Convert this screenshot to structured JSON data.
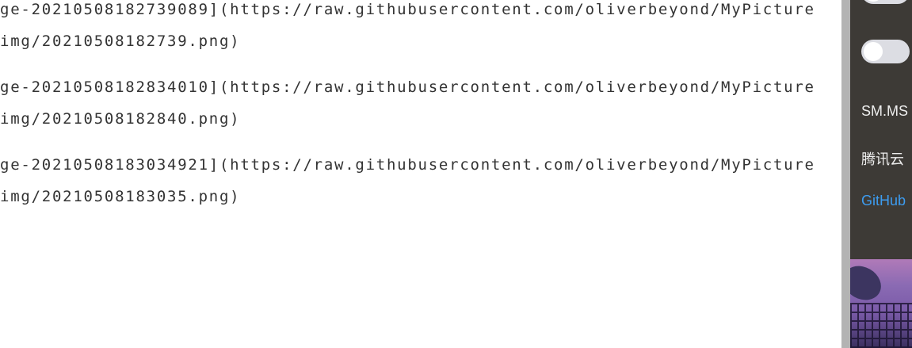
{
  "editor": {
    "lines": [
      "ge-20210508182739089](https://raw.githubusercontent.com/oliverbeyond/MyPicture",
      "img/20210508182739.png)",
      "ge-20210508182834010](https://raw.githubusercontent.com/oliverbeyond/MyPicture",
      "img/20210508182840.png)",
      "ge-20210508183034921](https://raw.githubusercontent.com/oliverbeyond/MyPicture",
      "img/20210508183035.png)"
    ]
  },
  "panel": {
    "toggles": [
      {
        "on": false
      },
      {
        "on": false
      }
    ],
    "options": [
      {
        "label": "SM.MS"
      },
      {
        "label": "腾讯云"
      },
      {
        "label": "GitHub",
        "color": "#3d9cf0"
      }
    ]
  }
}
